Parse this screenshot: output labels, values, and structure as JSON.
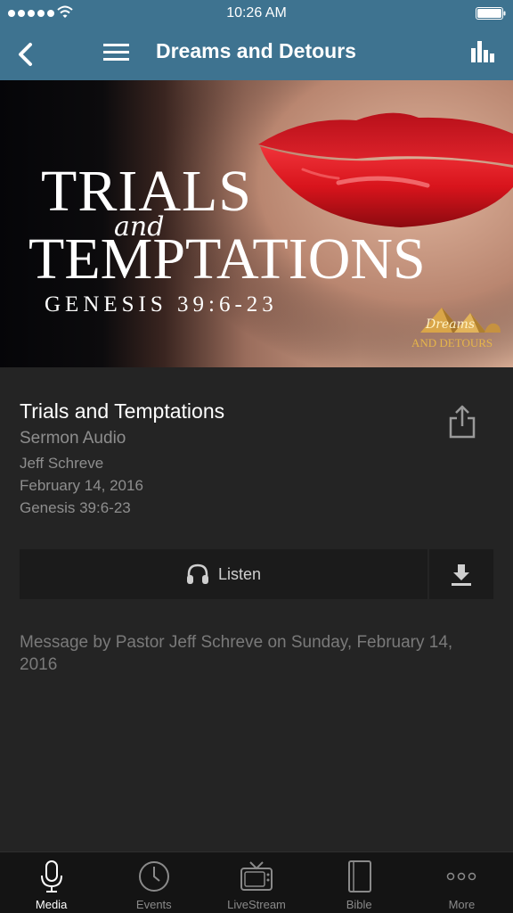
{
  "status_bar": {
    "time": "10:26 AM"
  },
  "nav": {
    "title": "Dreams and Detours"
  },
  "hero": {
    "title_line1": "TRIALS",
    "title_and": "and",
    "title_line2": "TEMPTATIONS",
    "reference": "GENESIS 39:6-23",
    "logo_top": "Dreams",
    "logo_bottom": "AND DETOURS"
  },
  "item": {
    "title": "Trials and Temptations",
    "type": "Sermon Audio",
    "speaker": "Jeff Schreve",
    "date": "February 14, 2016",
    "reference": "Genesis 39:6-23",
    "listen_label": "Listen",
    "description": "Message by Pastor Jeff Schreve on Sunday, February 14, 2016"
  },
  "tabs": [
    {
      "label": "Media",
      "icon": "microphone-icon",
      "active": true
    },
    {
      "label": "Events",
      "icon": "clock-icon",
      "active": false
    },
    {
      "label": "LiveStream",
      "icon": "tv-icon",
      "active": false
    },
    {
      "label": "Bible",
      "icon": "book-icon",
      "active": false
    },
    {
      "label": "More",
      "icon": "more-icon",
      "active": false
    }
  ],
  "colors": {
    "nav_bar": "#3e7390",
    "background": "#242424",
    "tab_bar": "#141414",
    "lips": "#d8141c"
  }
}
